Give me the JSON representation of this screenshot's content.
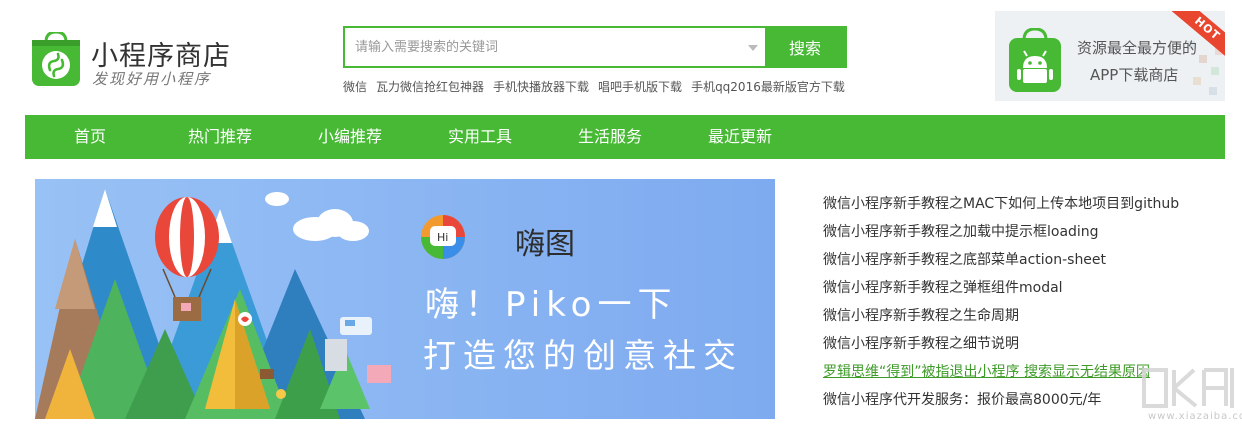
{
  "header": {
    "logo": {
      "title": "小程序商店",
      "slogan": "发现好用小程序",
      "icon": "miniprogram-bag-icon"
    },
    "search": {
      "placeholder": "请输入需要搜索的关键词",
      "button_label": "搜索"
    },
    "hot_keywords": [
      "微信",
      "瓦力微信抢红包神器",
      "手机快播放器下载",
      "唱吧手机版下载",
      "手机qq2016最新版官方下载"
    ],
    "app_ad": {
      "line1": "资源最全最方便的",
      "line2": "APP下载商店",
      "ribbon": "HOT",
      "icon": "android-bag-icon"
    }
  },
  "nav": {
    "items": [
      "首页",
      "热门推荐",
      "小编推荐",
      "实用工具",
      "生活服务",
      "最近更新"
    ]
  },
  "banner": {
    "brand_name": "嗨图",
    "brand_icon_label": "Hi",
    "slogan_line1": "嗨！Piko一下",
    "slogan_line2": "打造您的创意社交"
  },
  "articles": [
    "微信小程序新手教程之MAC下如何上传本地项目到github",
    "微信小程序新手教程之加载中提示框loading",
    "微信小程序新手教程之底部菜单action-sheet",
    "微信小程序新手教程之弹框组件modal",
    "微信小程序新手教程之生命周期",
    "微信小程序新手教程之细节说明",
    "罗辑思维“得到”被指退出小程序 搜索显示无结果原因",
    "微信小程序代开发服务：报价最高8000元/年"
  ],
  "highlighted_article_index": 6,
  "watermark": {
    "text": "www.xiazaiba.com"
  },
  "colors": {
    "brand_green": "#47b934",
    "link_green": "#3e9b29",
    "banner_sky": "#8ab4f2",
    "hot_red": "#e8462f"
  }
}
